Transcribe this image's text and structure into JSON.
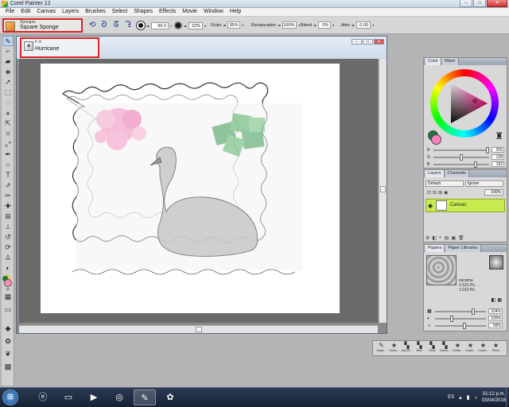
{
  "app": {
    "title": "Corel Painter 12"
  },
  "window_buttons": {
    "minimize": "–",
    "maximize": "□",
    "close": "✕"
  },
  "menu": [
    "File",
    "Edit",
    "Canvas",
    "Layers",
    "Brushes",
    "Select",
    "Shapes",
    "Effects",
    "Movie",
    "Window",
    "Help"
  ],
  "brush_selector": {
    "category": "Sponges",
    "variant": "Square Sponge"
  },
  "property_bar": {
    "size": "96.0",
    "opacity": "22%",
    "grain_label": "Grain",
    "grain": "35%",
    "resaturation_label": "Resaturation",
    "resaturation": "100%",
    "bleed_label": "Bleed",
    "bleed": "0%",
    "jitter_label": "Jitter",
    "jitter": "0.00"
  },
  "document_tab": {
    "category": "F-X",
    "name": "Hurricane"
  },
  "color_panel": {
    "tabs": [
      "Color",
      "Mixer"
    ],
    "main_color": "#ff80c0",
    "additional_color": "#1b7a3a",
    "r": "255",
    "g": "128",
    "b": "192",
    "r_label": "R",
    "g_label": "G",
    "b_label": "B",
    "r_level": 1.0,
    "g_level": 0.5,
    "b_level": 0.75
  },
  "layers_panel": {
    "tabs": [
      "Layers",
      "Channels"
    ],
    "composite_method": "Default",
    "preserve": "Ignore",
    "opacity": "100%",
    "layers": [
      {
        "name": "Canvas"
      }
    ]
  },
  "papers_panel": {
    "tabs": [
      "Papers",
      "Paper Libraries"
    ],
    "paper_name": "escama",
    "width": "1.531 Px.",
    "height": "1.010 Px.",
    "scale": "224%",
    "contrast": "100%",
    "brightness": "58%",
    "scale_level": 0.75,
    "contrast_level": 0.33,
    "brightness_level": 0.58
  },
  "brush_tracker": [
    "Squar...",
    "Hurric...",
    "Add Gr...",
    "Burn",
    "Glow",
    "Colore...",
    "Conflu...",
    "Coars...",
    "Coars...",
    "Pinch"
  ],
  "taskbar": {
    "language": "ES",
    "time": "01:12 p.m.",
    "date": "03/04/2018"
  }
}
